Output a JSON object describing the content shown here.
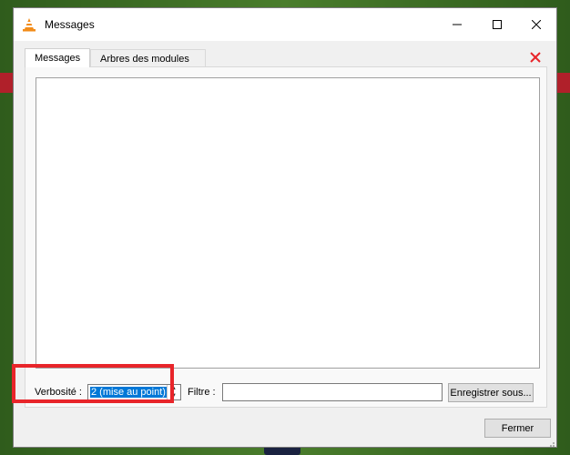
{
  "window": {
    "title": "Messages"
  },
  "tabs": [
    {
      "label": "Messages",
      "active": true
    },
    {
      "label": "Arbres des modules",
      "active": false
    }
  ],
  "controls": {
    "verbosity_label": "Verbosité :",
    "verbosity_value": "2 (mise au point)",
    "filter_label": "Filtre :",
    "filter_value": "",
    "save_label": "Enregistrer sous...",
    "close_label": "Fermer"
  },
  "icons": {
    "app": "vlc-cone-icon",
    "minimize": "minimize-icon",
    "maximize": "maximize-icon",
    "close": "close-icon",
    "clear": "red-x-icon"
  },
  "colors": {
    "accent_selection": "#0078d7",
    "clear_x": "#e8252a",
    "highlight_box": "#e8252a"
  }
}
